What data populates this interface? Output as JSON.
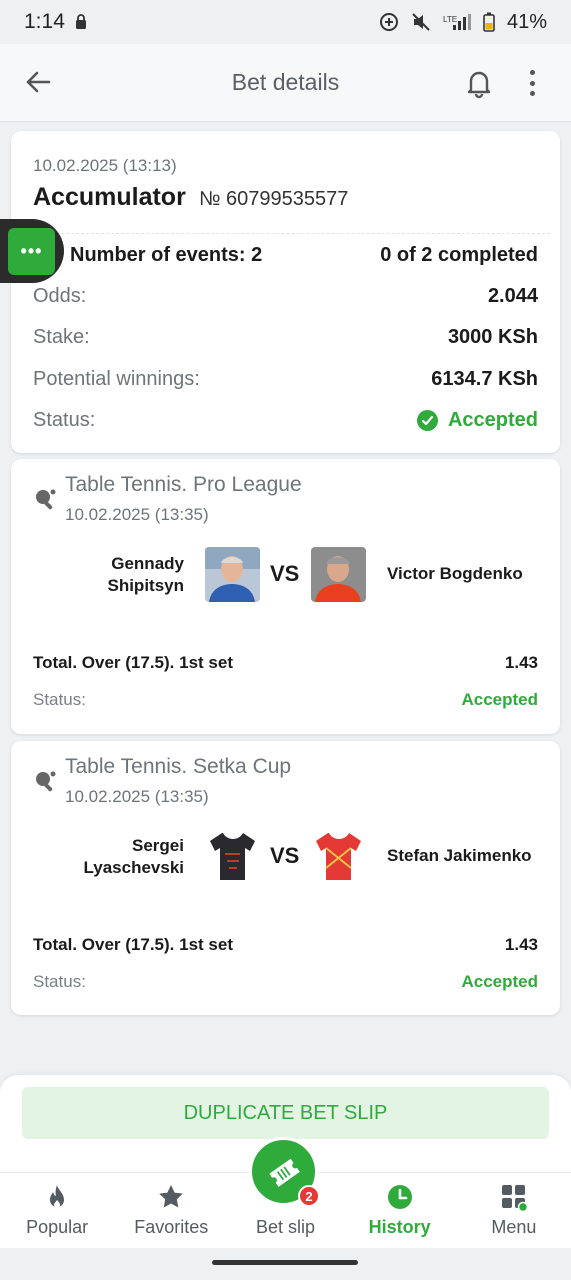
{
  "status_bar": {
    "time": "1:14",
    "battery": "41%"
  },
  "app_bar": {
    "title": "Bet details"
  },
  "bet": {
    "date": "10.02.2025 (13:13)",
    "type": "Accumulator",
    "number": "№ 60799535577",
    "events_label": "Number of events: 2",
    "completed": "0 of 2 completed",
    "odds_label": "Odds:",
    "odds_value": "2.044",
    "stake_label": "Stake:",
    "stake_value": "3000 KSh",
    "winnings_label": "Potential winnings:",
    "winnings_value": "6134.7 KSh",
    "status_label": "Status:",
    "status_value": "Accepted"
  },
  "side_tab": {
    "label": "•••"
  },
  "events": [
    {
      "league": "Table Tennis. Pro League",
      "date": "10.02.2025 (13:35)",
      "player1": "Gennady Shipitsyn",
      "player2": "Victor Bogdenko",
      "vs": "VS",
      "market": "Total. Over (17.5). 1st set",
      "odd": "1.43",
      "status_label": "Status:",
      "status_value": "Accepted"
    },
    {
      "league": "Table Tennis. Setka Cup",
      "date": "10.02.2025 (13:35)",
      "player1": "Sergei Lyaschevski",
      "player2": "Stefan Jakimenko",
      "vs": "VS",
      "market": "Total. Over (17.5). 1st set",
      "odd": "1.43",
      "status_label": "Status:",
      "status_value": "Accepted"
    }
  ],
  "duplicate_button": "DUPLICATE BET SLIP",
  "nav": {
    "items": [
      {
        "label": "Popular",
        "icon": "flame-icon"
      },
      {
        "label": "Favorites",
        "icon": "star-icon"
      },
      {
        "label": "Bet slip",
        "icon": "ticket-icon"
      },
      {
        "label": "History",
        "icon": "clock-icon"
      },
      {
        "label": "Menu",
        "icon": "grid-icon"
      }
    ],
    "bet_slip_count": "2"
  },
  "colors": {
    "accent": "#2fab3c",
    "badge": "#e53935"
  }
}
